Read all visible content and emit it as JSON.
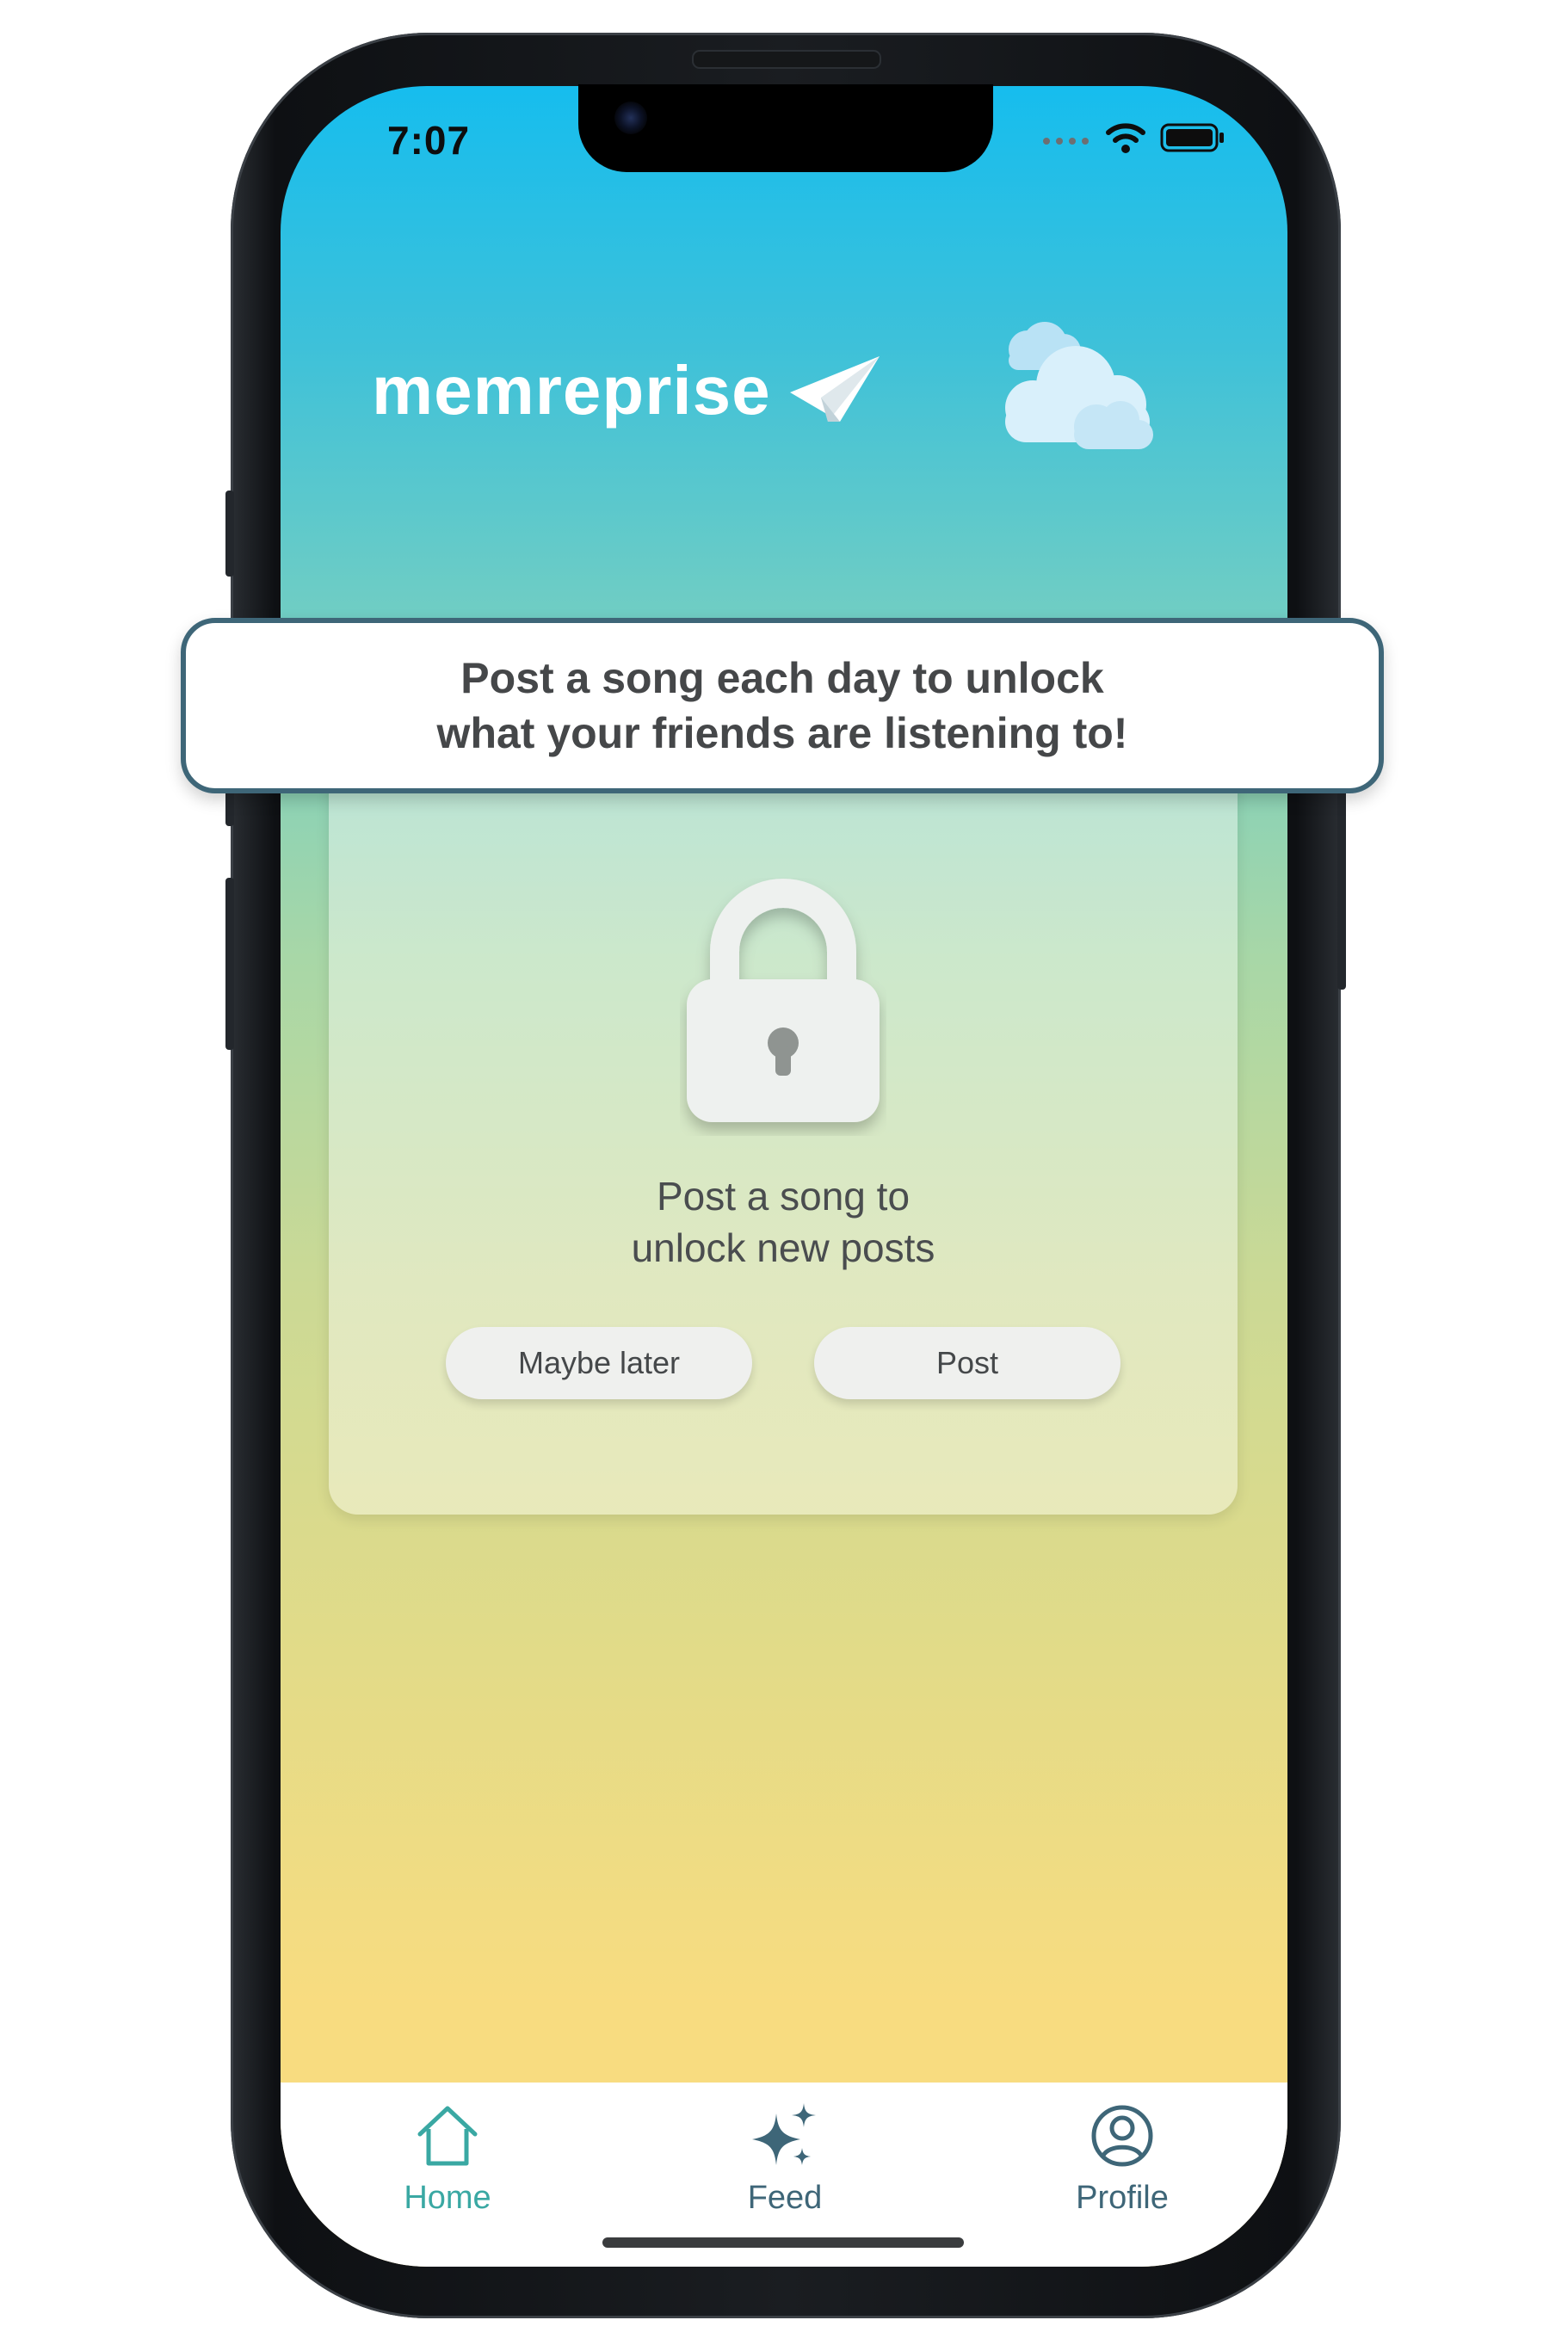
{
  "status_bar": {
    "time": "7:07"
  },
  "header": {
    "app_name": "memreprise"
  },
  "banner": {
    "text": "Post a song each day to unlock\nwhat your friends are listening to!"
  },
  "locked_card": {
    "message": "Post a song to\nunlock new posts",
    "secondary_button": "Maybe later",
    "primary_button": "Post"
  },
  "tab_bar": {
    "items": [
      {
        "label": "Home",
        "icon": "home-icon",
        "active": true
      },
      {
        "label": "Feed",
        "icon": "sparkles-icon",
        "active": false
      },
      {
        "label": "Profile",
        "icon": "profile-icon",
        "active": false
      }
    ]
  },
  "colors": {
    "accent_active": "#3aa8a3",
    "tab_inactive": "#3e6678",
    "banner_border": "#3e6678",
    "gradient_top": "#16bdee",
    "gradient_bottom": "#f8dc80"
  }
}
